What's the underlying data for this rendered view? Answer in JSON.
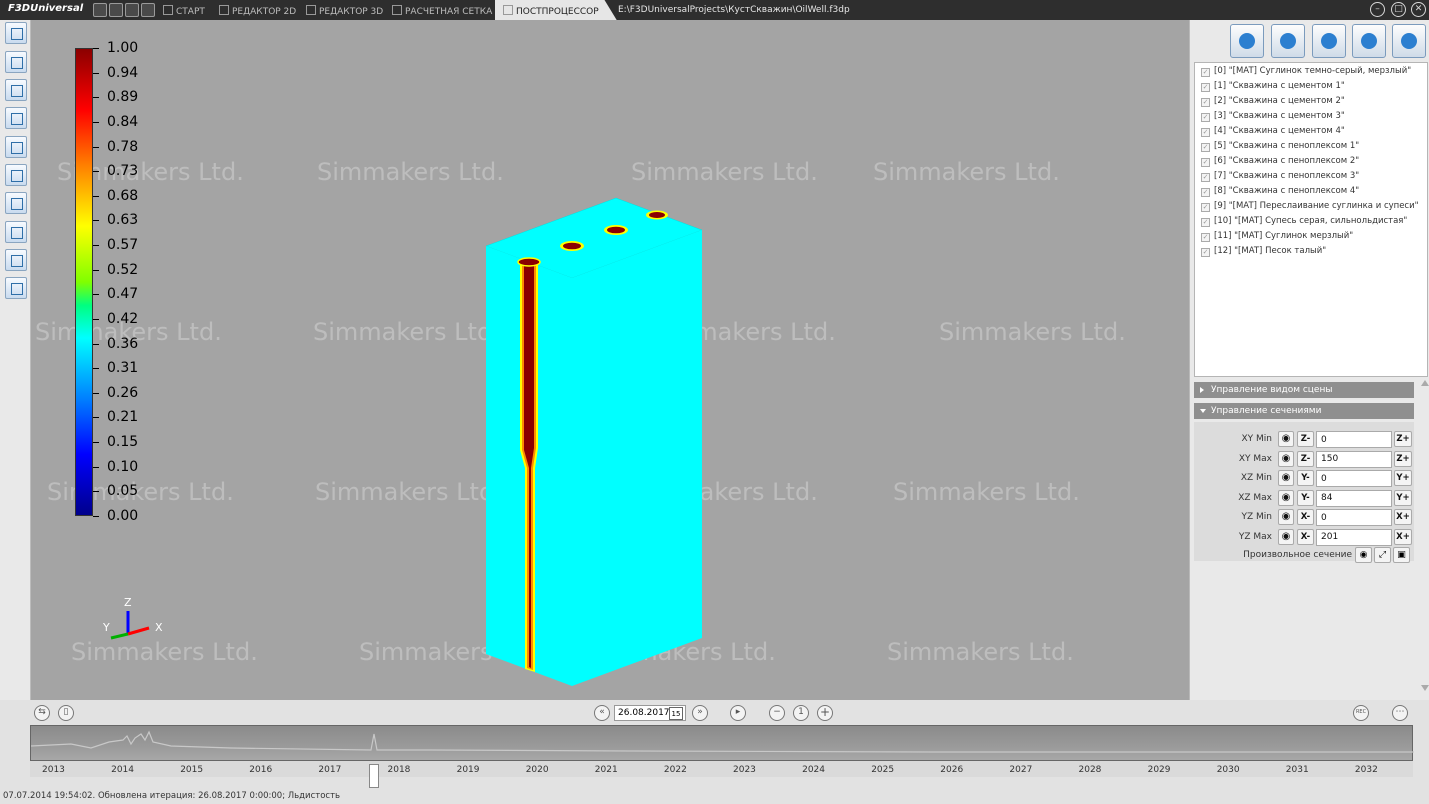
{
  "app": {
    "logo": "F3DUniversal",
    "tabs": [
      "СТАРТ",
      "РЕДАКТОР 2D",
      "РЕДАКТОР 3D",
      "РАСЧЕТНАЯ СЕТКА",
      "ПОСТПРОЦЕССОР"
    ],
    "active_tab": "ПОСТПРОЦЕССОР",
    "file_path": "E:\\F3DUniversalProjects\\КустСкважин\\OilWell.f3dp"
  },
  "viewport": {
    "watermark": "Simmakers Ltd.",
    "legend_values": [
      "1.00",
      "0.94",
      "0.89",
      "0.84",
      "0.78",
      "0.73",
      "0.68",
      "0.63",
      "0.57",
      "0.52",
      "0.47",
      "0.42",
      "0.36",
      "0.31",
      "0.26",
      "0.21",
      "0.15",
      "0.10",
      "0.05",
      "0.00"
    ],
    "axes": {
      "z": "Z",
      "y": "Y",
      "x": "X"
    },
    "colors": {
      "field": "#00ffff",
      "well": "#8b0000",
      "background": "#a4a4a4"
    }
  },
  "materials": [
    "[0] \"[MAT] Суглинок темно-серый, мерзлый\"",
    "[1] \"Скважина с цементом 1\"",
    "[2] \"Скважина с цементом 2\"",
    "[3] \"Скважина с цементом 3\"",
    "[4] \"Скважина с цементом 4\"",
    "[5] \"Скважина с пеноплексом 1\"",
    "[6] \"Скважина с пеноплексом 2\"",
    "[7] \"Скважина с пеноплексом 3\"",
    "[8] \"Скважина с пеноплексом 4\"",
    "[9] \"[MAT] Переслаивание суглинка и супеси\"",
    "[10] \"[MAT] Супесь серая, сильнольдистая\"",
    "[11] \"[MAT] Суглинок мерзлый\"",
    "[12] \"[MAT] Песок талый\""
  ],
  "panels": {
    "scene_view": "Управление видом сцены",
    "sections": "Управление сечениями"
  },
  "section_rows": [
    {
      "label": "XY Min",
      "minus": "Z-",
      "value": "0",
      "plus": "Z+"
    },
    {
      "label": "XY Max",
      "minus": "Z-",
      "value": "150",
      "plus": "Z+"
    },
    {
      "label": "XZ Min",
      "minus": "Y-",
      "value": "0",
      "plus": "Y+"
    },
    {
      "label": "XZ Max",
      "minus": "Y-",
      "value": "84",
      "plus": "Y+"
    },
    {
      "label": "YZ Min",
      "minus": "X-",
      "value": "0",
      "plus": "X+"
    },
    {
      "label": "YZ Max",
      "minus": "X-",
      "value": "201",
      "plus": "X+"
    }
  ],
  "arbitrary_section": "Произвольное сечение",
  "playback": {
    "date": "26.08.2017",
    "calendar_day": "15",
    "step": "1",
    "rec": "REC"
  },
  "timeline_years": [
    "2013",
    "2014",
    "2015",
    "2016",
    "2017",
    "2018",
    "2019",
    "2020",
    "2021",
    "2022",
    "2023",
    "2024",
    "2025",
    "2026",
    "2027",
    "2028",
    "2029",
    "2030",
    "2031",
    "2032"
  ],
  "status_text": "07.07.2014 19:54:02. Обновлена итерация: 26.08.2017 0:00:00; Льдистость"
}
